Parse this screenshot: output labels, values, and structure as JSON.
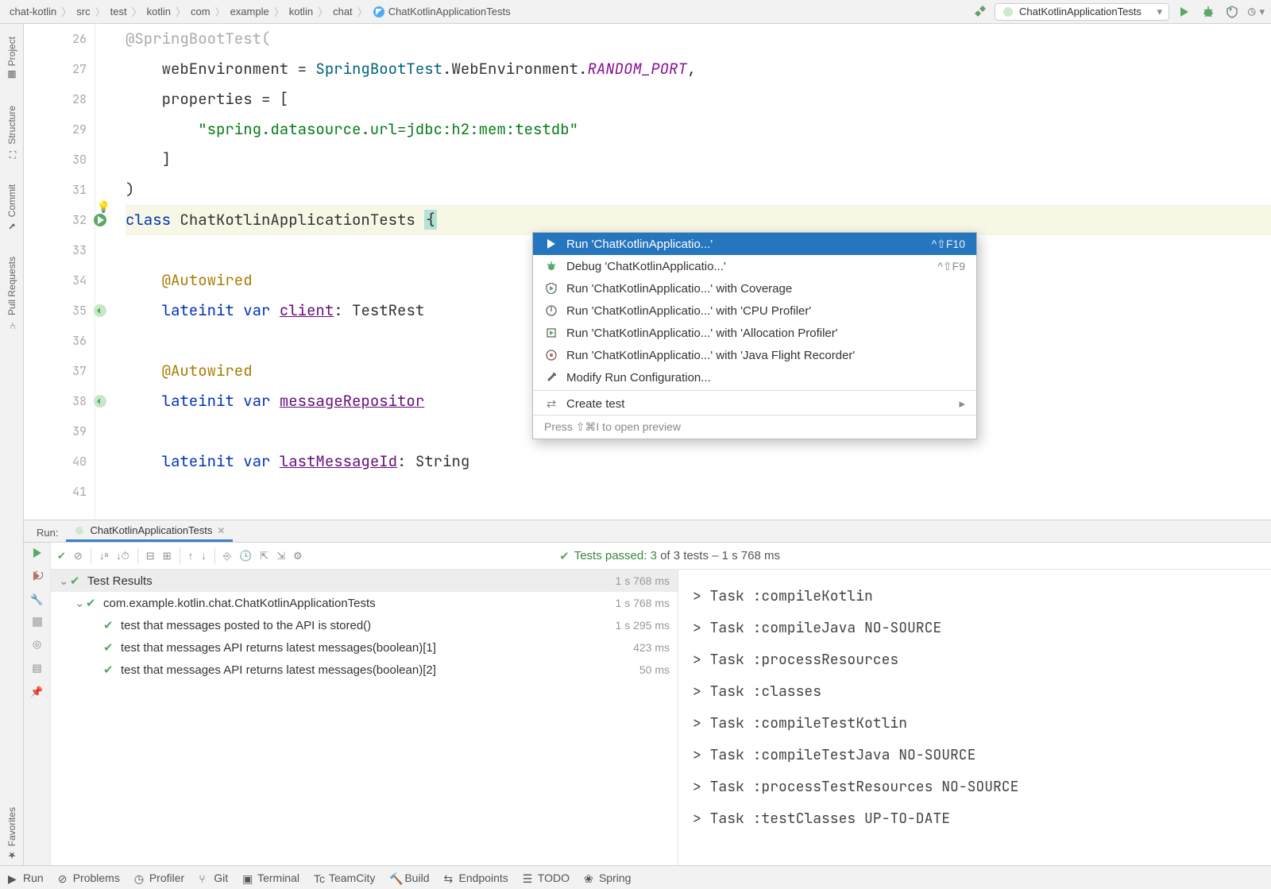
{
  "breadcrumb": [
    "chat-kotlin",
    "src",
    "test",
    "kotlin",
    "com",
    "example",
    "kotlin",
    "chat",
    "ChatKotlinApplicationTests"
  ],
  "runConfig": {
    "name": "ChatKotlinApplicationTests"
  },
  "leftStripe": [
    "Project",
    "Structure",
    "Commit",
    "Pull Requests",
    "Favorites"
  ],
  "gutterStart": 26,
  "code": {
    "l27": {
      "indent": "    ",
      "id": "webEnvironment",
      "eq": " = ",
      "fn": "SpringBootTest",
      "dot1": ".",
      "t1": "WebEnvironment",
      "dot2": ".",
      "enum": "RANDOM_PORT",
      "comma": ","
    },
    "l28": {
      "indent": "    ",
      "id": "properties",
      "eq": " = ["
    },
    "l29": {
      "indent": "        ",
      "str": "\"spring.datasource.url=jdbc:h2:mem:testdb\""
    },
    "l30": {
      "indent": "    ]"
    },
    "l31": {
      "text": ")"
    },
    "l32": {
      "kw": "class",
      "sp": " ",
      "name": "ChatKotlinApplicationTests",
      "sp2": " ",
      "brace": "{"
    },
    "l34": {
      "indent": "    ",
      "ann": "@Autowired"
    },
    "l35": {
      "indent": "    ",
      "kw": "lateinit var",
      "sp": " ",
      "var": "client",
      "colon": ": ",
      "type": "TestRest"
    },
    "l37": {
      "indent": "    ",
      "ann": "@Autowired"
    },
    "l38": {
      "indent": "    ",
      "kw": "lateinit var",
      "sp": " ",
      "var": "messageRepositor"
    },
    "l40": {
      "indent": "    ",
      "kw": "lateinit var",
      "sp": " ",
      "var": "lastMessageId",
      "colon": ": ",
      "type": "String"
    }
  },
  "ctxMenu": {
    "items": [
      {
        "icon": "play",
        "label": "Run 'ChatKotlinApplicatio...'",
        "shortcut": "^⇧F10",
        "selected": true
      },
      {
        "icon": "bug",
        "label": "Debug 'ChatKotlinApplicatio...'",
        "shortcut": "^⇧F9"
      },
      {
        "icon": "coverage",
        "label": "Run 'ChatKotlinApplicatio...' with Coverage"
      },
      {
        "icon": "cpu",
        "label": "Run 'ChatKotlinApplicatio...' with 'CPU Profiler'"
      },
      {
        "icon": "alloc",
        "label": "Run 'ChatKotlinApplicatio...' with 'Allocation Profiler'"
      },
      {
        "icon": "jfr",
        "label": "Run 'ChatKotlinApplicatio...' with 'Java Flight Recorder'"
      },
      {
        "icon": "wrench",
        "label": "Modify Run Configuration..."
      }
    ],
    "sepAfter": 6,
    "createTest": "Create test",
    "hint": "Press ⇧⌘I to open preview"
  },
  "runWin": {
    "label": "Run:",
    "tab": "ChatKotlinApplicationTests",
    "status": {
      "prefix": "Tests passed: 3",
      "suffix": " of 3 tests – 1 s 768 ms"
    },
    "tree": [
      {
        "level": 0,
        "chev": "v",
        "pass": true,
        "label": "Test Results",
        "time": "1 s 768 ms",
        "header": true
      },
      {
        "level": 1,
        "chev": "v",
        "pass": true,
        "label": "com.example.kotlin.chat.ChatKotlinApplicationTests",
        "time": "1 s 768 ms"
      },
      {
        "level": 2,
        "pass": true,
        "label": "test that messages posted to the API is stored()",
        "time": "1 s 295 ms"
      },
      {
        "level": 2,
        "pass": true,
        "label": "test that messages API returns latest messages(boolean)[1]",
        "time": "423 ms"
      },
      {
        "level": 2,
        "pass": true,
        "label": "test that messages API returns latest messages(boolean)[2]",
        "time": "50 ms"
      }
    ],
    "console": [
      "> Task :compileKotlin",
      "> Task :compileJava NO-SOURCE",
      "> Task :processResources",
      "> Task :classes",
      "> Task :compileTestKotlin",
      "> Task :compileTestJava NO-SOURCE",
      "> Task :processTestResources NO-SOURCE",
      "> Task :testClasses UP-TO-DATE"
    ]
  },
  "bottomBar": [
    "Run",
    "Problems",
    "Profiler",
    "Git",
    "Terminal",
    "TeamCity",
    "Build",
    "Endpoints",
    "TODO",
    "Spring"
  ]
}
